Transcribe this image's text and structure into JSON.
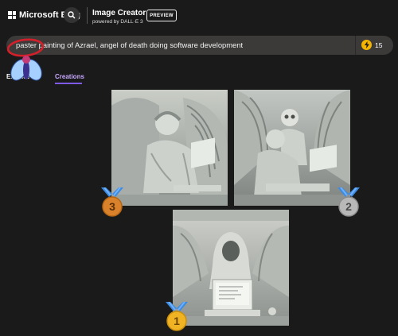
{
  "header": {
    "brand": "Microsoft Bing",
    "title": "Image Creator",
    "subtitle": "powered by DALL·E 3",
    "preview_badge": "PREVIEW"
  },
  "prompt": {
    "text": "paster painting of Azrael, angel of death doing software development",
    "boost_count": "15"
  },
  "tabs": [
    {
      "label": "Explore"
    },
    {
      "label": "Creations"
    }
  ],
  "images": [
    {
      "icon": "angel-laptop-image"
    },
    {
      "icon": "angel-skeleton-image"
    },
    {
      "icon": "hooded-reaper-computer-image"
    }
  ],
  "medals": [
    {
      "rank": "3",
      "color": "#d9822b"
    },
    {
      "rank": "2",
      "color": "#b8b8b8"
    },
    {
      "rank": "1",
      "color": "#f0b323"
    }
  ],
  "colors": {
    "background": "#1b1a1a",
    "prompt_bar": "#3b3a39",
    "accent_tab": "#c8a8ff",
    "boost": "#f5b400",
    "annotation_red": "#d4202a"
  }
}
